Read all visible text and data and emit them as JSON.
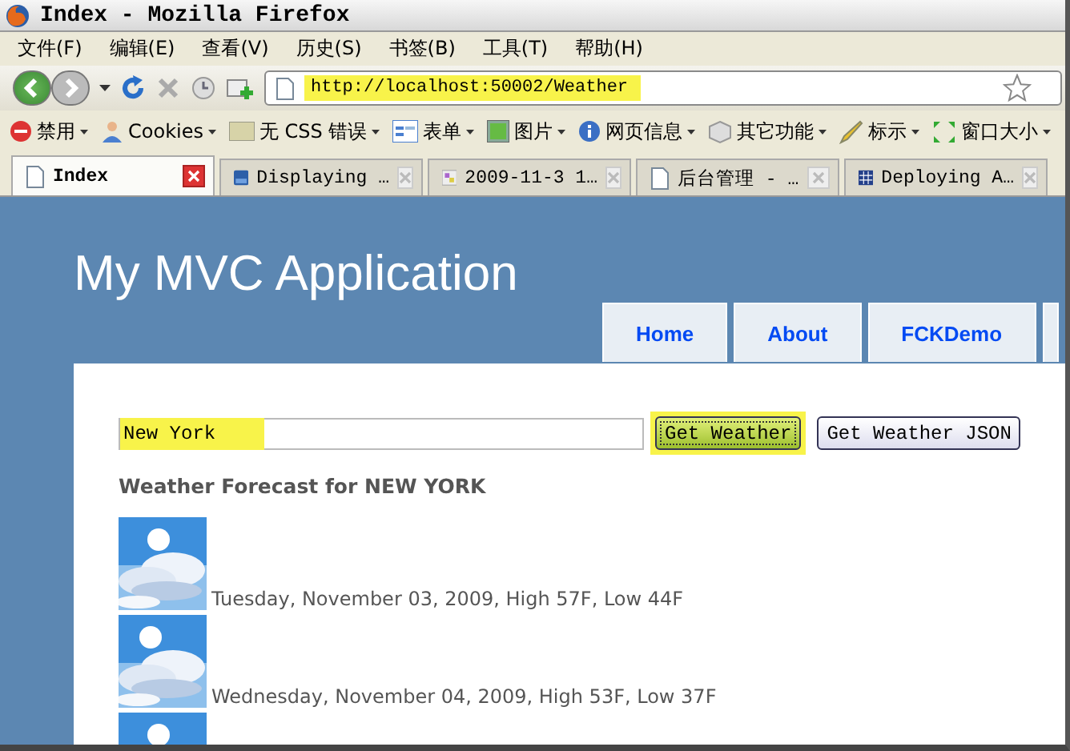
{
  "window": {
    "title": "Index - Mozilla Firefox"
  },
  "menu": [
    "文件(F)",
    "编辑(E)",
    "查看(V)",
    "历史(S)",
    "书签(B)",
    "工具(T)",
    "帮助(H)"
  ],
  "address": {
    "value": "http://localhost:50002/Weather"
  },
  "toolbar": [
    "禁用",
    "Cookies",
    "无 CSS 错误",
    "表单",
    "图片",
    "网页信息",
    "其它功能",
    "标示",
    "窗口大小"
  ],
  "tabs": [
    {
      "label": "Index",
      "selected": true
    },
    {
      "label": "Displaying …",
      "selected": false
    },
    {
      "label": "2009-11-3 1…",
      "selected": false
    },
    {
      "label": "后台管理 - …",
      "selected": false
    },
    {
      "label": "Deploying A…",
      "selected": false
    }
  ],
  "site": {
    "title": "My MVC Application",
    "nav": [
      "Home",
      "About",
      "FCKDemo"
    ]
  },
  "search": {
    "value": "New York",
    "buttons": [
      {
        "label": "Get Weather",
        "selected": true
      },
      {
        "label": "Get Weather JSON",
        "selected": false
      }
    ]
  },
  "heading": "Weather Forecast for NEW YORK",
  "forecast": [
    {
      "kind": "day",
      "text": "Tuesday, November 03, 2009, High 57F, Low 44F"
    },
    {
      "kind": "day",
      "text": "Wednesday, November 04, 2009, High 53F, Low 37F"
    },
    {
      "kind": "picture"
    }
  ]
}
